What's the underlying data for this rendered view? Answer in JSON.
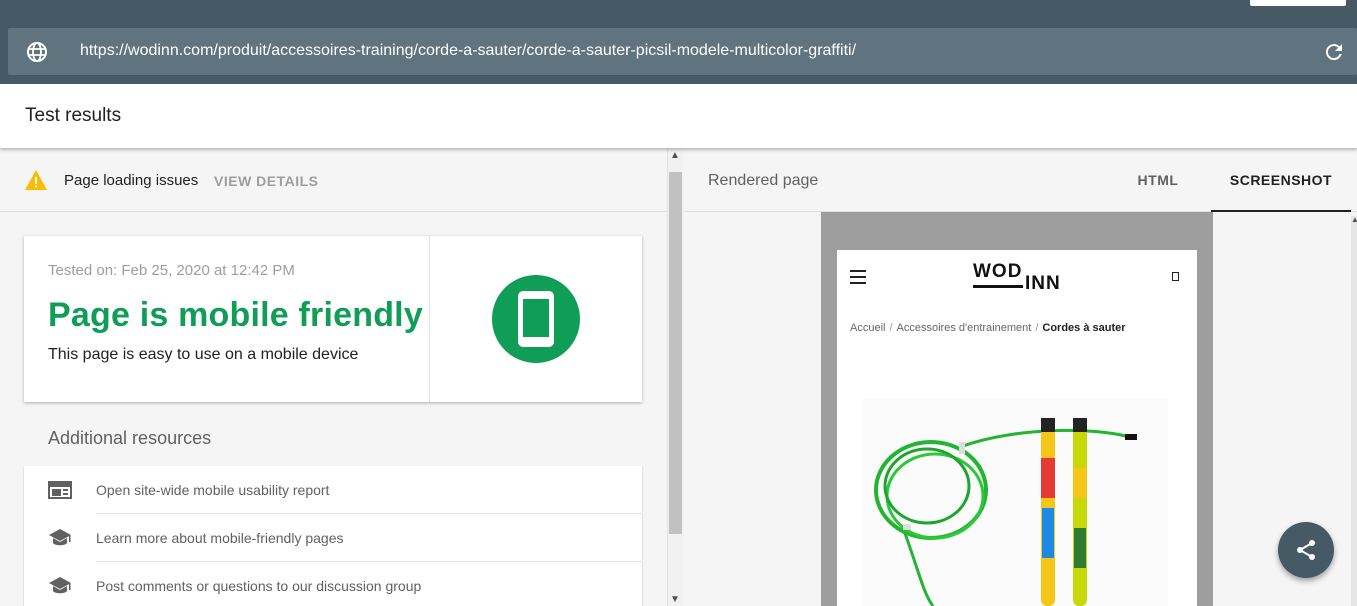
{
  "url_bar": {
    "url": "https://wodinn.com/produit/accessoires-training/corde-a-sauter/corde-a-sauter-picsil-modele-multicolor-graffiti/",
    "globe_icon": "globe-icon",
    "reload_icon": "reload-icon"
  },
  "header": {
    "title": "Test results"
  },
  "issues": {
    "text": "Page loading issues",
    "action": "VIEW DETAILS",
    "icon": "warning-icon"
  },
  "verdict": {
    "tested_on": "Tested on: Feb 25, 2020 at 12:42 PM",
    "title": "Page is mobile friendly",
    "subtitle": "This page is easy to use on a mobile device",
    "icon": "phone-icon",
    "color": "#0f9d58"
  },
  "resources": {
    "title": "Additional resources",
    "items": [
      {
        "label": "Open site-wide mobile usability report",
        "icon": "report-icon"
      },
      {
        "label": "Learn more about mobile-friendly pages",
        "icon": "school-icon"
      },
      {
        "label": "Post comments or questions to our discussion group",
        "icon": "school-icon"
      }
    ]
  },
  "rendered": {
    "label": "Rendered page",
    "tabs": [
      {
        "label": "HTML",
        "selected": false
      },
      {
        "label": "SCREENSHOT",
        "selected": true
      }
    ]
  },
  "preview": {
    "logo_top": "WOD",
    "logo_bottom": "INN",
    "breadcrumb": [
      "Accueil",
      "Accessoires d'entrainement",
      "Cordes à sauter"
    ]
  },
  "colors": {
    "topbar": "#455a64",
    "accent_green": "#0f9d58",
    "warning": "#fbbc04"
  }
}
